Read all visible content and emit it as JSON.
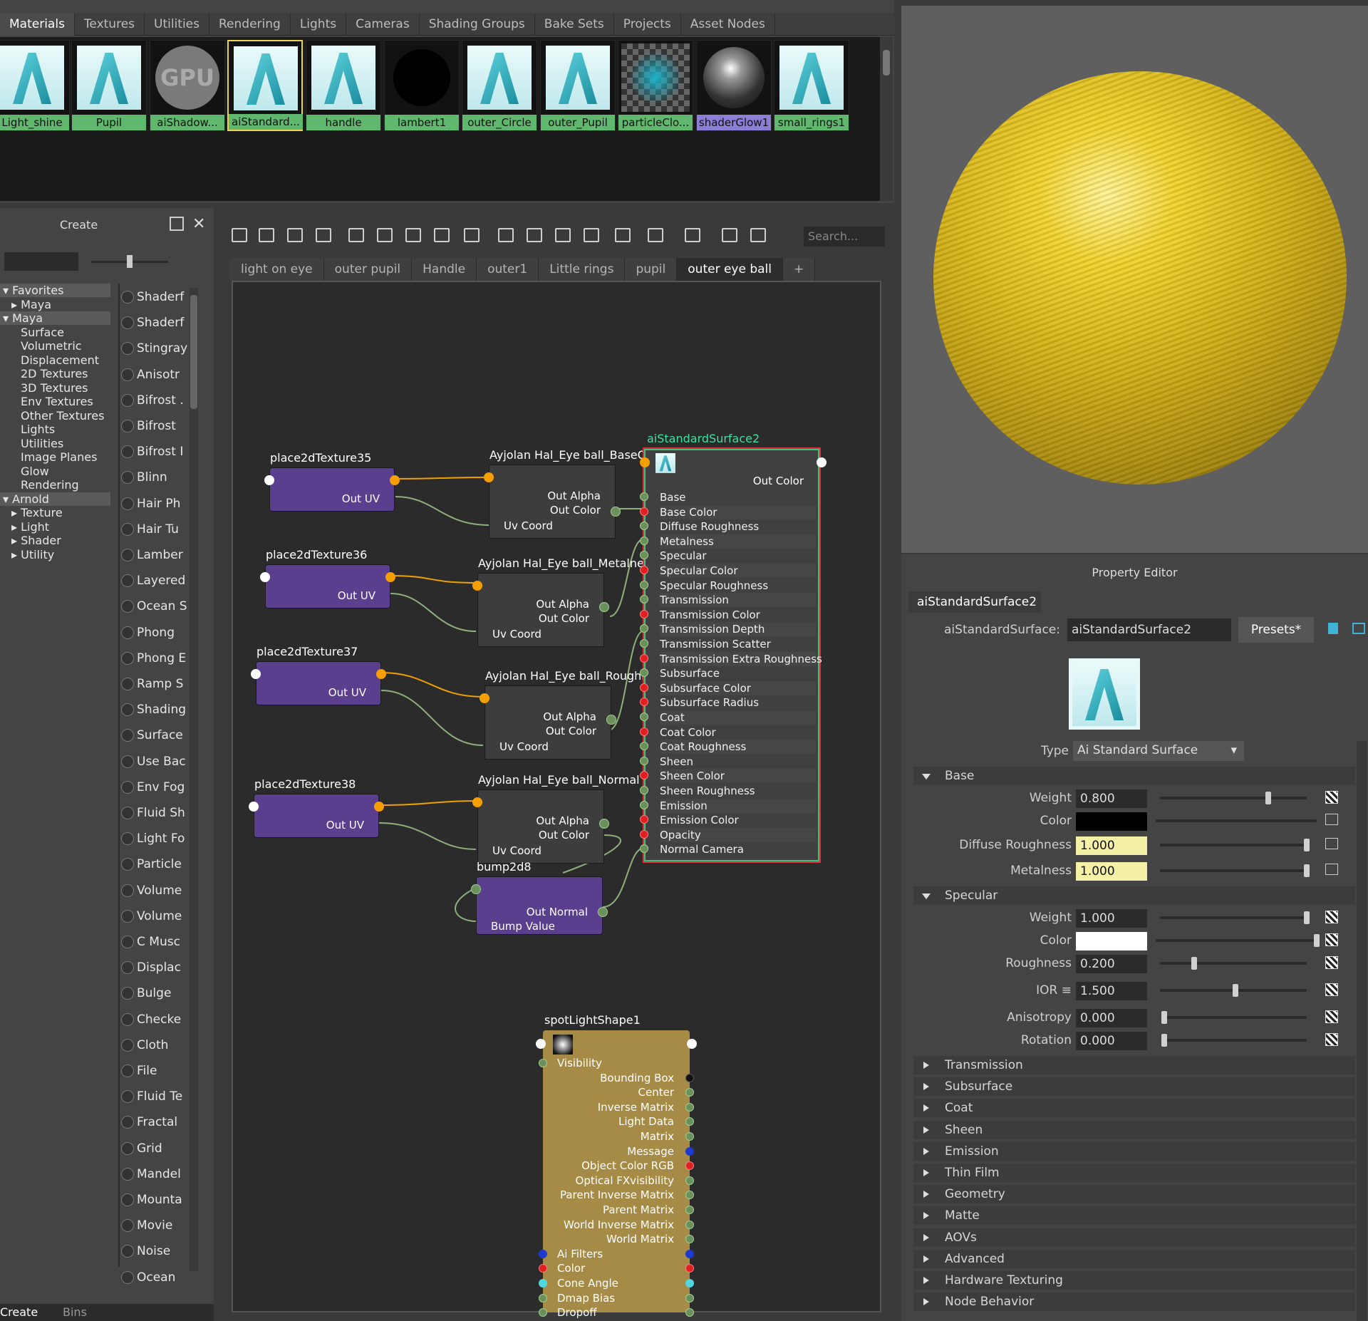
{
  "material_tabs": [
    "Materials",
    "Textures",
    "Utilities",
    "Rendering",
    "Lights",
    "Cameras",
    "Shading Groups",
    "Bake Sets",
    "Projects",
    "Asset Nodes"
  ],
  "swatches": [
    "Light_shine",
    "Pupil",
    "aiShadow...",
    "aiStandard...",
    "handle",
    "lambert1",
    "outer_Circle",
    "outer_Pupil",
    "particleClo...",
    "shaderGlow1",
    "small_rings1"
  ],
  "create_panel": {
    "title": "Create",
    "tree": [
      "Favorites",
      "Maya",
      "Maya",
      "Surface",
      "Volumetric",
      "Displacement",
      "2D Textures",
      "3D Textures",
      "Env Textures",
      "Other Textures",
      "Lights",
      "Utilities",
      "Image Planes",
      "Glow",
      "Rendering",
      "Arnold",
      "Texture",
      "Light",
      "Shader",
      "Utility"
    ],
    "nodes": [
      "Shaderf",
      "Shaderf",
      "Stingray",
      "Anisotr",
      "Bifrost .",
      "Bifrost",
      "Bifrost I",
      "Blinn",
      "Hair Ph",
      "Hair Tu",
      "Lamber",
      "Layered",
      "Ocean S",
      "Phong",
      "Phong E",
      "Ramp S",
      "Shading",
      "Surface",
      "Use Bac",
      "Env Fog",
      "Fluid Sh",
      "Light Fo",
      "Particle",
      "Volume",
      "Volume",
      "C Musc",
      "Displac",
      "Bulge",
      "Checke",
      "Cloth",
      "File",
      "Fluid Te",
      "Fractal",
      "Grid",
      "Mandel",
      "Mounta",
      "Movie",
      "Noise",
      "Ocean"
    ],
    "footer_tabs": [
      "Create",
      "Bins"
    ]
  },
  "node_editor": {
    "search_placeholder": "Search...",
    "tabs": [
      "light on eye",
      "outer pupil",
      "Handle",
      "outer1",
      "Little rings",
      "pupil",
      "outer eye ball",
      "+"
    ],
    "place_nodes": [
      {
        "name": "place2dTexture35",
        "out": "Out UV"
      },
      {
        "name": "place2dTexture36",
        "out": "Out UV"
      },
      {
        "name": "place2dTexture37",
        "out": "Out UV"
      },
      {
        "name": "place2dTexture38",
        "out": "Out UV"
      }
    ],
    "file_nodes": [
      {
        "name": "Ayjolan Hal_Eye ball_BaseC",
        "a": "Out Alpha",
        "c": "Out Color",
        "uv": "Uv Coord"
      },
      {
        "name": "Ayjolan Hal_Eye ball_Metalne",
        "a": "Out Alpha",
        "c": "Out Color",
        "uv": "Uv Coord"
      },
      {
        "name": "Ayjolan Hal_Eye ball_Roughi",
        "a": "Out Alpha",
        "c": "Out Color",
        "uv": "Uv Coord"
      },
      {
        "name": "Ayjolan Hal_Eye ball_Normal",
        "a": "Out Alpha",
        "c": "Out Color",
        "uv": "Uv Coord"
      }
    ],
    "bump": {
      "name": "bump2d8",
      "out": "Out Normal",
      "in": "Bump Value"
    },
    "surface": {
      "name": "aiStandardSurface2",
      "out": "Out Color",
      "attrs": [
        "Base",
        "Base Color",
        "Diffuse Roughness",
        "Metalness",
        "Specular",
        "Specular Color",
        "Specular Roughness",
        "Transmission",
        "Transmission Color",
        "Transmission Depth",
        "Transmission Scatter",
        "Transmission Extra Roughness",
        "Subsurface",
        "Subsurface Color",
        "Subsurface Radius",
        "Coat",
        "Coat Color",
        "Coat Roughness",
        "Sheen",
        "Sheen Color",
        "Sheen Roughness",
        "Emission",
        "Emission Color",
        "Opacity",
        "Normal Camera"
      ]
    },
    "spot": {
      "name": "spotLightShape1",
      "attrs": [
        "Visibility",
        "Bounding Box",
        "Center",
        "Inverse Matrix",
        "Light Data",
        "Matrix",
        "Message",
        "Object Color RGB",
        "Optical FXvisibility",
        "Parent Inverse Matrix",
        "Parent Matrix",
        "World Inverse Matrix",
        "World Matrix",
        "Ai Filters",
        "Color",
        "Cone Angle",
        "Dmap Bias",
        "Dropoff"
      ]
    }
  },
  "property_editor": {
    "title": "Property Editor",
    "tab": "aiStandardSurface2",
    "node_label": "aiStandardSurface:",
    "node_value": "aiStandardSurface2",
    "presets": "Presets*",
    "type_label": "Type",
    "type_value": "Ai Standard Surface",
    "base": {
      "title": "Base",
      "weight_l": "Weight",
      "weight": "0.800",
      "weight_level": 0.8,
      "color_l": "Color",
      "dr_l": "Diffuse Roughness",
      "dr": "1.000",
      "met_l": "Metalness",
      "met": "1.000"
    },
    "specular": {
      "title": "Specular",
      "weight_l": "Weight",
      "weight": "1.000",
      "color_l": "Color",
      "rough_l": "Roughness",
      "rough": "0.200",
      "ior_l": "IOR ≡",
      "ior": "1.500",
      "aniso_l": "Anisotropy",
      "aniso": "0.000",
      "rot_l": "Rotation",
      "rot": "0.000"
    },
    "sections": [
      "Transmission",
      "Subsurface",
      "Coat",
      "Sheen",
      "Emission",
      "Thin Film",
      "Geometry",
      "Matte",
      "AOVs",
      "Advanced",
      "Hardware Texturing",
      "Node Behavior"
    ]
  },
  "colors": {
    "accent": "#5fb86d",
    "surface_border": "#e0303a",
    "place_node": "#5a3f8f",
    "spot_node": "#a58b45",
    "sphere": "#d9b81c"
  }
}
